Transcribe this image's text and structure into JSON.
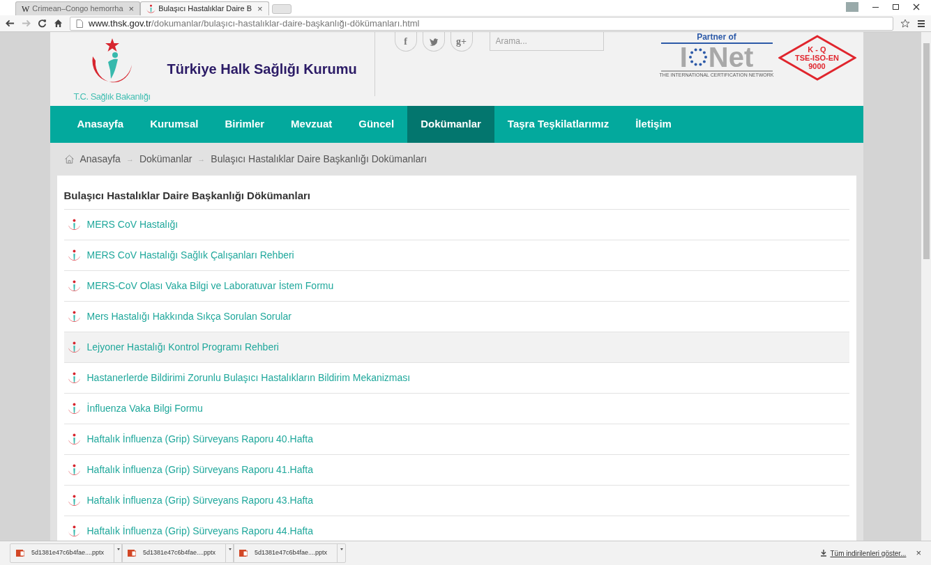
{
  "browser": {
    "tabs": [
      {
        "title": "Crimean–Congo hemorrha",
        "selected": false
      },
      {
        "title": "Bulaşıcı Hastalıklar Daire B",
        "selected": true
      }
    ],
    "wiki_letter": "W",
    "close": "×",
    "url_host": "www.thsk.gov.tr",
    "url_path": "/dokumanlar/bulaşıcı-hastalıklar-daire-başkanlığı-dökümanları.html"
  },
  "header": {
    "ministry": "T.C. Sağlık Bakanlığı",
    "institution": "Türkiye Halk Sağlığı Kurumu",
    "search": {
      "placeholder": "Arama..."
    },
    "social": [
      "f",
      "g+"
    ],
    "iqnet": {
      "partner": "Partner of",
      "letter": "I",
      "word": "Net",
      "tagline": "THE INTERNATIONAL CERTIFICATION NETWORK"
    },
    "tse": [
      "K - Q",
      "TSE-ISO-EN",
      "9000"
    ]
  },
  "nav": [
    {
      "label": "Anasayfa",
      "selected": false
    },
    {
      "label": "Kurumsal",
      "selected": false
    },
    {
      "label": "Birimler",
      "selected": false
    },
    {
      "label": "Mevzuat",
      "selected": false
    },
    {
      "label": "Güncel",
      "selected": false
    },
    {
      "label": "Dokümanlar",
      "selected": true
    },
    {
      "label": "Taşra Teşkilatlarımız",
      "selected": false
    },
    {
      "label": "İletişim",
      "selected": false
    }
  ],
  "breadcrumb": [
    "Anasayfa",
    "Dokümanlar",
    "Bulaşıcı Hastalıklar Daire Başkanlığı Dokümanları"
  ],
  "breadcrumb_separator": "→",
  "page_title": "Bulaşıcı Hastalıklar Daire Başkanlığı Dökümanları",
  "documents": [
    {
      "title": "MERS CoV Hastalığı",
      "highlighted": false
    },
    {
      "title": "MERS CoV Hastalığı Sağlık Çalışanları Rehberi",
      "highlighted": false
    },
    {
      "title": "MERS-CoV Olası Vaka Bilgi ve Laboratuvar İstem Formu",
      "highlighted": false
    },
    {
      "title": "Mers Hastalığı Hakkında Sıkça Sorulan Sorular",
      "highlighted": false
    },
    {
      "title": "Lejyoner Hastalığı Kontrol Programı Rehberi",
      "highlighted": true
    },
    {
      "title": "Hastanerlerde Bildirimi Zorunlu Bulaşıcı Hastalıkların Bildirim Mekanizması",
      "highlighted": false
    },
    {
      "title": "İnfluenza Vaka Bilgi Formu",
      "highlighted": false
    },
    {
      "title": "Haftalık İnfluenza (Grip) Sürveyans Raporu 40.Hafta",
      "highlighted": false
    },
    {
      "title": "Haftalık İnfluenza (Grip) Sürveyans Raporu 41.Hafta",
      "highlighted": false
    },
    {
      "title": "Haftalık İnfluenza (Grip) Sürveyans Raporu 43.Hafta",
      "highlighted": false
    },
    {
      "title": "Haftalık İnfluenza (Grip) Sürveyans Raporu 44.Hafta",
      "highlighted": false
    }
  ],
  "downloads": {
    "files": [
      "5d1381e47c6b4fae....pptx",
      "5d1381e47c6b4fae....pptx",
      "5d1381e47c6b4fae....pptx"
    ],
    "show_all": "Tüm indirilenleri göster...",
    "close": "×"
  }
}
